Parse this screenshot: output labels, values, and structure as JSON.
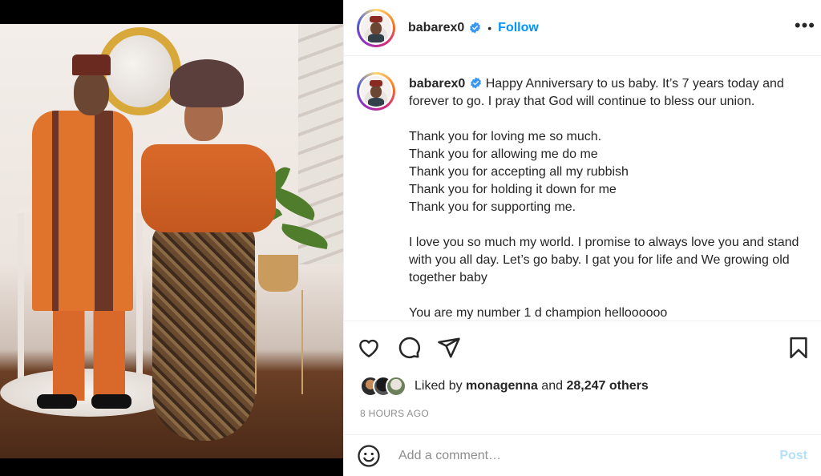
{
  "post": {
    "username": "babarex0",
    "follow_label": "Follow",
    "separator": "•",
    "more_label": "•••",
    "caption": {
      "username": "babarex0",
      "paragraphs": [
        "Happy Anniversary to us baby. It’s 7 years today and forever to go. I pray that God will continue to bless our union.",
        "Thank you for loving me so much.\nThank you for allowing me do me\nThank you for accepting all my rubbish\nThank you for holding it down for me\nThank you for supporting me.",
        "I love you so much my world. I promise to always love you and stand with you all day. Let’s go baby. I gat you for life and We growing old together baby",
        "You are my number 1 d champion helloooooo"
      ]
    },
    "likes": {
      "prefix": "Liked by",
      "liker": "monagenna",
      "conjunction": "and",
      "others": "28,247 others"
    },
    "timestamp": "8 HOURS AGO",
    "comment": {
      "placeholder": "Add a comment…",
      "post_label": "Post"
    }
  },
  "colors": {
    "link": "#0095f6",
    "post_disabled": "#b2dffc",
    "muted": "#8e8e8e",
    "verified": "#3897f0"
  }
}
